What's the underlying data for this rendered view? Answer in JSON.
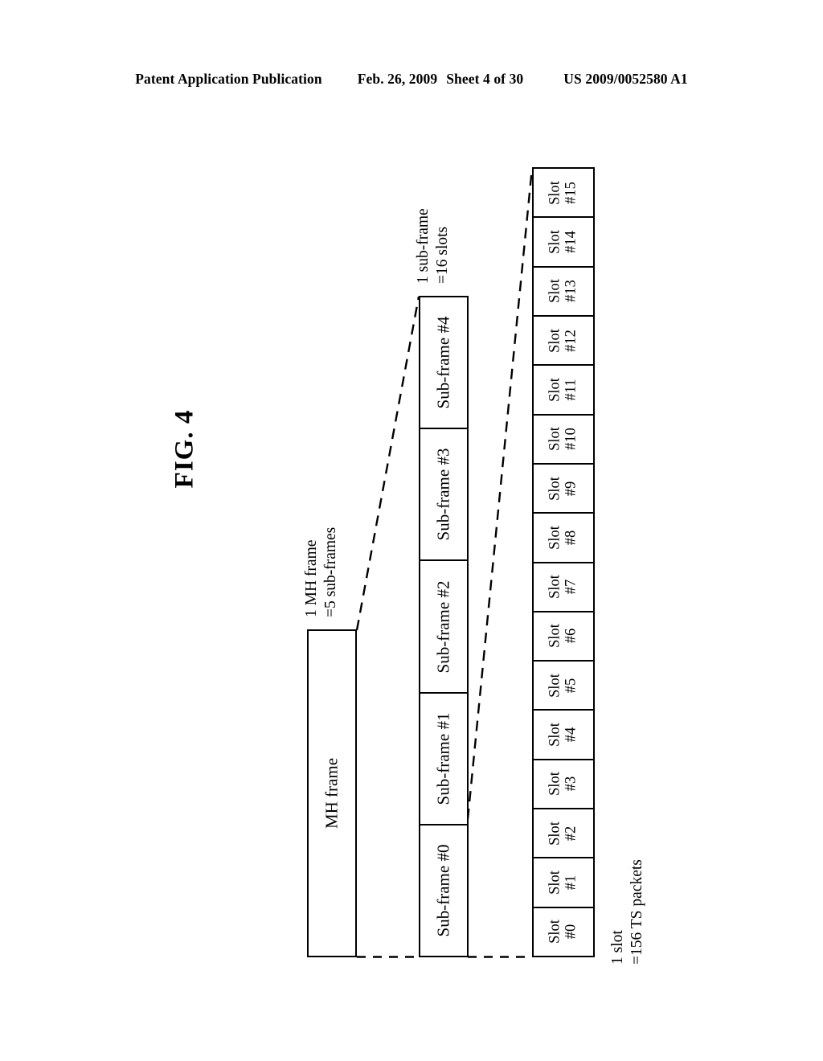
{
  "header": {
    "publication": "Patent Application Publication",
    "date": "Feb. 26, 2009",
    "sheet": "Sheet 4 of 30",
    "patent_number": "US 2009/0052580 A1"
  },
  "figure": {
    "caption": "FIG. 4"
  },
  "mh_frame": {
    "label": "MH frame",
    "annotation_line1": "1 MH frame",
    "annotation_line2": "=5 sub-frames"
  },
  "subframes": {
    "annotation_line1": "1 sub-frame",
    "annotation_line2": "=16 slots",
    "cells": [
      {
        "label": "Sub-frame #4"
      },
      {
        "label": "Sub-frame #3"
      },
      {
        "label": "Sub-frame #2"
      },
      {
        "label": "Sub-frame #1"
      },
      {
        "label": "Sub-frame #0"
      }
    ]
  },
  "slots": {
    "annotation_line1": "1 slot",
    "annotation_line2": "=156 TS packets",
    "cells": [
      {
        "line1": "Slot",
        "line2": "#15"
      },
      {
        "line1": "Slot",
        "line2": "#14"
      },
      {
        "line1": "Slot",
        "line2": "#13"
      },
      {
        "line1": "Slot",
        "line2": "#12"
      },
      {
        "line1": "Slot",
        "line2": "#11"
      },
      {
        "line1": "Slot",
        "line2": "#10"
      },
      {
        "line1": "Slot",
        "line2": "#9"
      },
      {
        "line1": "Slot",
        "line2": "#8"
      },
      {
        "line1": "Slot",
        "line2": "#7"
      },
      {
        "line1": "Slot",
        "line2": "#6"
      },
      {
        "line1": "Slot",
        "line2": "#5"
      },
      {
        "line1": "Slot",
        "line2": "#4"
      },
      {
        "line1": "Slot",
        "line2": "#3"
      },
      {
        "line1": "Slot",
        "line2": "#2"
      },
      {
        "line1": "Slot",
        "line2": "#1"
      },
      {
        "line1": "Slot",
        "line2": "#0"
      }
    ]
  },
  "colors": {
    "ink": "#000000",
    "paper": "#ffffff"
  }
}
